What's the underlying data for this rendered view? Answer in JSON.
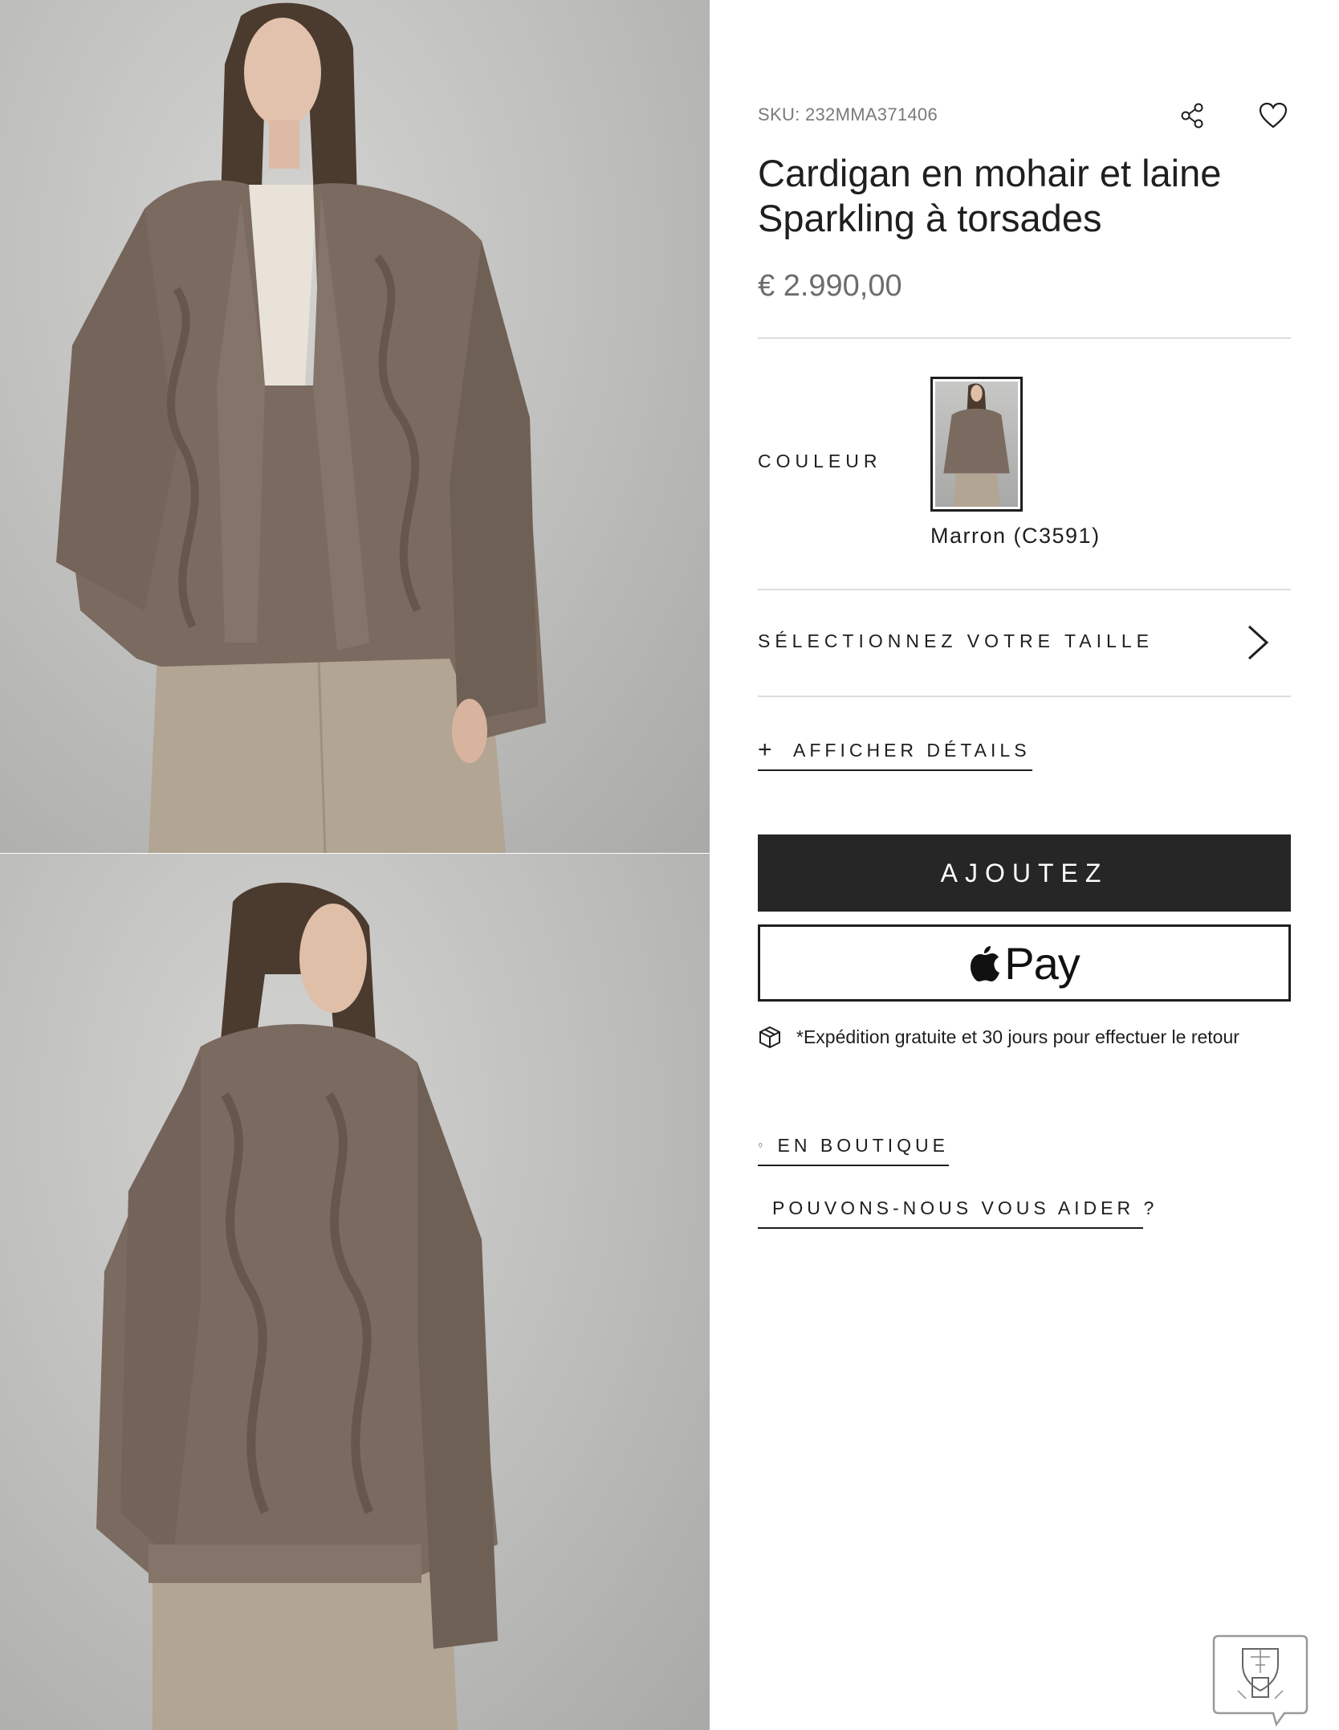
{
  "product": {
    "sku": "SKU: 232MMA371406",
    "title": "Cardigan en mohair et laine Sparkling à torsades",
    "price": "€ 2.990,00"
  },
  "gallery": {
    "images": [
      "model-front-photo",
      "model-back-photo"
    ]
  },
  "color": {
    "label": "COULEUR",
    "selected_name": "Marron (C3591)"
  },
  "size": {
    "label": "SÉLECTIONNEZ VOTRE TAILLE"
  },
  "details": {
    "label": "AFFICHER DÉTAILS"
  },
  "actions": {
    "add_label": "AJOUTEZ",
    "apple_pay_label": "Pay"
  },
  "shipping": {
    "text": "*Expédition gratuite et 30 jours pour effectuer le retour"
  },
  "links": {
    "store": "EN BOUTIQUE",
    "help": "POUVONS-NOUS VOUS AIDER ?"
  },
  "icons": [
    "share-icon",
    "heart-icon",
    "plus-icon",
    "chevron-right-icon",
    "apple-logo-icon",
    "box-icon",
    "location-pin-icon",
    "envelope-icon",
    "chat-crest-icon"
  ],
  "colors": {
    "primary_button": "#262626",
    "text": "#1e1e1e",
    "muted": "#7a7a7a",
    "divider": "#dcdcdc",
    "sweater": "#7a6a5f",
    "trousers": "#b2a594"
  }
}
